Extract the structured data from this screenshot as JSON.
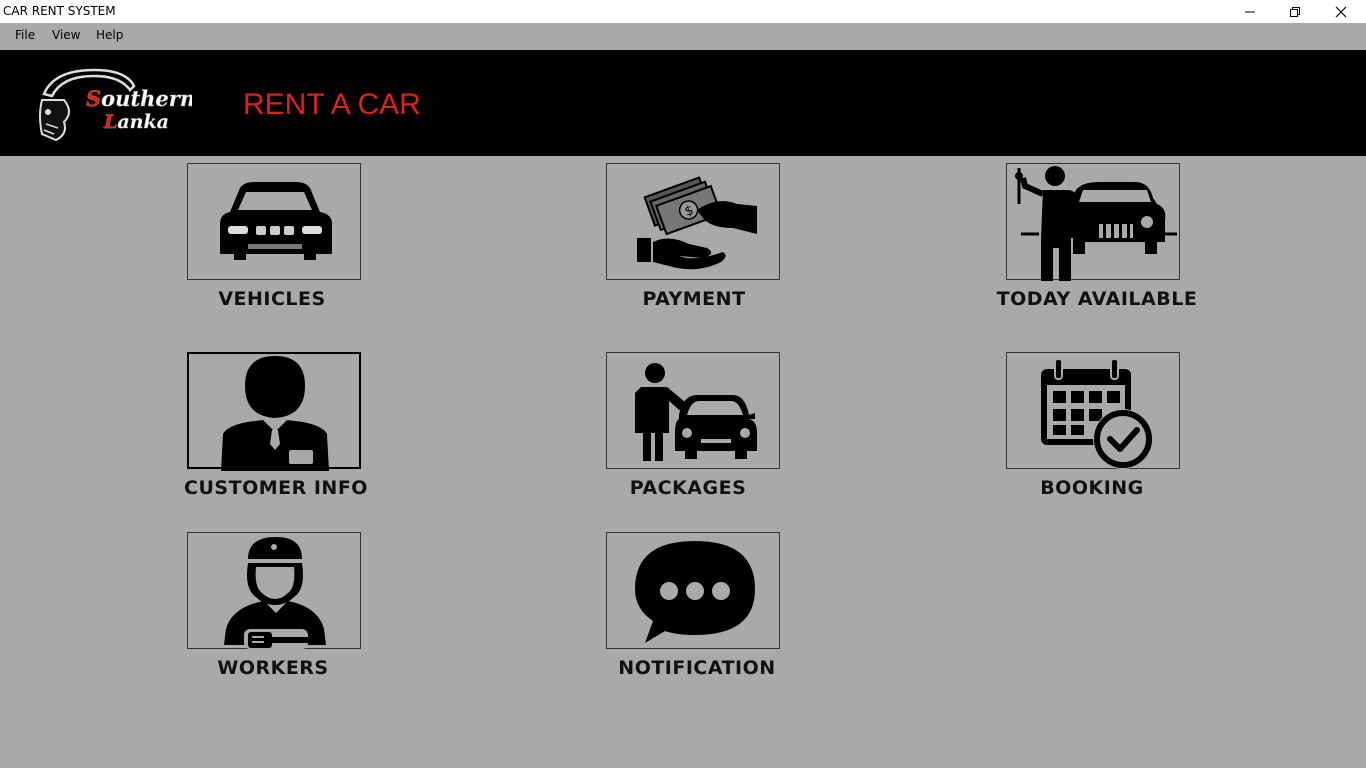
{
  "window": {
    "title": "CAR RENT SYSTEM",
    "controls": [
      "minimize-icon",
      "restore-icon",
      "close-icon"
    ]
  },
  "menu": {
    "file": "File",
    "view": "View",
    "help": "Help"
  },
  "banner": {
    "logo_text": "Southern Lanka",
    "heading": "RENT A CAR",
    "heading_color": "#e0201a"
  },
  "tiles": {
    "vehicles": {
      "label": "VEHICLES",
      "icon": "car-front-icon"
    },
    "payment": {
      "label": "PAYMENT",
      "icon": "money-handover-icon"
    },
    "today_available": {
      "label": "TODAY AVAILABLE",
      "icon": "person-car-keys-icon"
    },
    "customer_info": {
      "label": "CUSTOMER INFO",
      "icon": "customer-icon"
    },
    "packages": {
      "label": "PACKAGES",
      "icon": "person-with-car-icon"
    },
    "booking": {
      "label": "BOOKING",
      "icon": "calendar-check-icon"
    },
    "workers": {
      "label": "WORKERS",
      "icon": "mechanic-icon"
    },
    "notification": {
      "label": "NOTIFICATION",
      "icon": "chat-bubble-icon"
    }
  }
}
